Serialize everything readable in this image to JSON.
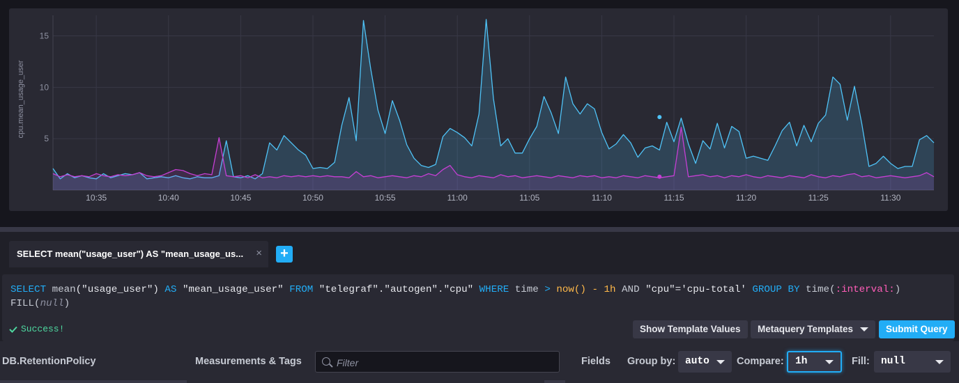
{
  "chart_data": {
    "type": "area",
    "ylabel": "cpu.mean_usage_user",
    "xlabel": "",
    "ylim": [
      0,
      17
    ],
    "yticks": [
      5,
      10,
      15
    ],
    "x_tick_labels": [
      "10:35",
      "10:40",
      "10:45",
      "10:50",
      "10:55",
      "11:00",
      "11:05",
      "11:10",
      "11:15",
      "11:20",
      "11:25",
      "11:30"
    ],
    "x_start": "10:32",
    "x_step_minutes": 0.5,
    "grid": true,
    "legend": "none",
    "series": [
      {
        "color": "#4fc3f7",
        "values": [
          2.1,
          1.1,
          1.6,
          1.2,
          1.4,
          1.2,
          1.1,
          1.6,
          1.2,
          1.4,
          1.6,
          1.5,
          1.7,
          1.1,
          1.2,
          1.3,
          1.2,
          1.4,
          1.2,
          1.1,
          1.3,
          1.2,
          1.2,
          1.4,
          4.8,
          1.3,
          1.2,
          1.4,
          1.1,
          1.6,
          4.6,
          3.9,
          5.3,
          4.6,
          3.9,
          3.4,
          2.1,
          2.2,
          2.1,
          2.7,
          6.3,
          9.0,
          4.8,
          16.5,
          11.8,
          7.8,
          5.5,
          8.7,
          6.8,
          4.4,
          3.1,
          2.4,
          2.2,
          2.5,
          5.2,
          6.0,
          5.6,
          5.1,
          4.3,
          7.4,
          16.6,
          8.9,
          4.3,
          5.0,
          3.6,
          3.6,
          5.0,
          6.2,
          9.1,
          7.5,
          5.5,
          11.0,
          8.4,
          7.4,
          8.4,
          7.9,
          5.6,
          4.0,
          4.5,
          5.4,
          4.6,
          3.2,
          4.1,
          4.3,
          3.9,
          6.6,
          4.7,
          7.0,
          4.5,
          2.6,
          4.8,
          4.0,
          6.5,
          4.1,
          6.2,
          5.7,
          3.1,
          3.3,
          3.1,
          2.9,
          4.3,
          5.8,
          6.6,
          4.3,
          6.3,
          4.7,
          6.5,
          7.3,
          11.0,
          10.3,
          6.8,
          10.1,
          6.5,
          2.3,
          2.6,
          3.3,
          2.6,
          2.1,
          2.3,
          2.3,
          4.9,
          5.3,
          4.6
        ]
      },
      {
        "color": "#c63fd4",
        "values": [
          1.6,
          1.3,
          1.5,
          1.3,
          1.4,
          1.3,
          1.6,
          1.4,
          1.3,
          1.5,
          1.4,
          1.5,
          1.7,
          1.4,
          1.3,
          1.4,
          1.7,
          2.0,
          1.9,
          1.6,
          1.4,
          1.6,
          1.5,
          5.1,
          1.4,
          1.3,
          1.4,
          1.2,
          1.5,
          1.2,
          1.3,
          1.2,
          1.4,
          1.3,
          1.4,
          1.3,
          1.4,
          1.3,
          1.4,
          1.3,
          1.3,
          1.2,
          1.8,
          1.3,
          1.4,
          1.2,
          1.3,
          1.4,
          1.3,
          1.2,
          1.4,
          1.3,
          1.6,
          1.4,
          2.0,
          2.4,
          1.5,
          1.3,
          1.2,
          1.4,
          1.3,
          1.2,
          1.5,
          1.3,
          1.4,
          1.2,
          1.3,
          1.4,
          1.3,
          1.2,
          1.4,
          1.3,
          1.2,
          1.4,
          1.3,
          1.4,
          1.2,
          1.3,
          1.2,
          1.4,
          1.3,
          1.2,
          1.4,
          1.3,
          1.2,
          1.3,
          1.4,
          6.1,
          1.3,
          1.4,
          1.5,
          1.3,
          1.4,
          1.2,
          1.4,
          1.3,
          1.5,
          1.3,
          1.2,
          1.4,
          1.3,
          1.2,
          1.4,
          1.3,
          1.2,
          1.5,
          1.3,
          1.2,
          1.4,
          1.3,
          1.5,
          1.6,
          1.3,
          1.4,
          1.2,
          1.3,
          1.4,
          1.3,
          1.2,
          1.3,
          1.4,
          1.7,
          1.3
        ]
      }
    ],
    "hover_points": [
      {
        "series": 0,
        "x": "11:14",
        "y": 7.1
      },
      {
        "series": 1,
        "x": "11:14",
        "y": 1.3
      }
    ]
  },
  "tab": {
    "label": "SELECT mean(\"usage_user\") AS \"mean_usage_us...",
    "close_glyph": "×",
    "add_glyph": "+"
  },
  "query": {
    "select": "SELECT",
    "fn_mean": "mean",
    "field": "(\"usage_user\")",
    "as": "AS",
    "alias": "\"mean_usage_user\"",
    "from": "FROM",
    "source": "\"telegraf\".\"autogen\".\"cpu\"",
    "where": "WHERE",
    "time": "time",
    "gt": ">",
    "now": "now()",
    "minus": "-",
    "dur": "1h",
    "and": "AND",
    "cond": "\"cpu\"='cpu-total'",
    "group": "GROUP BY",
    "time_fn": "time(",
    "interval": ":interval:",
    "close_paren": ")",
    "fill": "FILL(",
    "null_kw": "null",
    "fill_close": ")"
  },
  "status": {
    "icon": "check-icon",
    "text": "Success!"
  },
  "buttons": {
    "template_values": "Show Template Values",
    "metaquery": "Metaquery Templates",
    "submit": "Submit Query"
  },
  "builder": {
    "db_label": "DB.RetentionPolicy",
    "measurements_label": "Measurements & Tags",
    "filter_placeholder": "Filter",
    "fields_label": "Fields",
    "group_by_label": "Group by:",
    "group_by_value": "auto",
    "compare_label": "Compare:",
    "compare_value": "1h",
    "fill_label": "Fill:",
    "fill_value": "null"
  },
  "colors": {
    "accent": "#22adf6",
    "success": "#4ed8a0",
    "series_1": "#4fc3f7",
    "series_2": "#c63fd4"
  }
}
